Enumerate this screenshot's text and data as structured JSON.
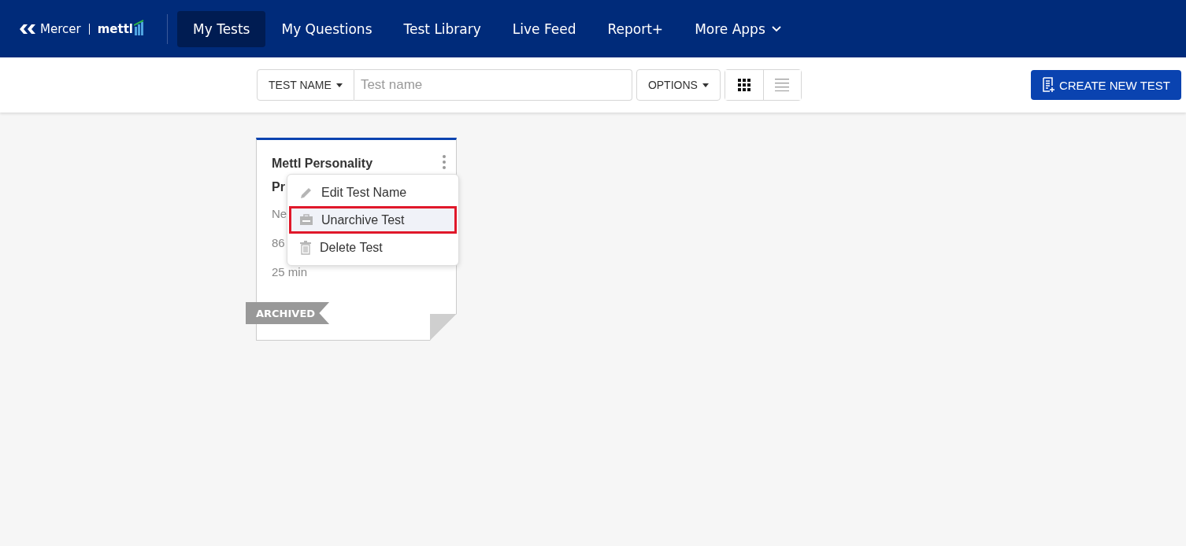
{
  "header": {
    "logo": {
      "brand": "Mercer",
      "product": "mettl"
    },
    "nav": [
      {
        "label": "My Tests",
        "selected": true,
        "dropdown": false
      },
      {
        "label": "My Questions",
        "selected": false,
        "dropdown": false
      },
      {
        "label": "Test Library",
        "selected": false,
        "dropdown": false
      },
      {
        "label": "Live Feed",
        "selected": false,
        "dropdown": false
      },
      {
        "label": "Report+",
        "selected": false,
        "dropdown": false
      },
      {
        "label": "More Apps",
        "selected": false,
        "dropdown": true
      }
    ]
  },
  "toolbar": {
    "filter": "TEST NAME",
    "search": {
      "placeholder": "Test name"
    },
    "options": "OPTIONS",
    "views": [
      {
        "kind": "grid",
        "selected": true
      },
      {
        "kind": "list",
        "selected": false
      }
    ],
    "create_button": "CREATE NEW TEST"
  },
  "card": {
    "title_lines": [
      "Mettl Personality",
      "Pr"
    ],
    "details": [
      "Ne",
      "86",
      "25 min"
    ],
    "ribbon": "ARCHIVED",
    "menu": [
      {
        "kind": "edit",
        "label": "Edit Test Name",
        "selected": false
      },
      {
        "kind": "unarchive",
        "label": "Unarchive Test",
        "selected": true
      },
      {
        "kind": "delete",
        "label": "Delete Test",
        "selected": false
      }
    ]
  }
}
